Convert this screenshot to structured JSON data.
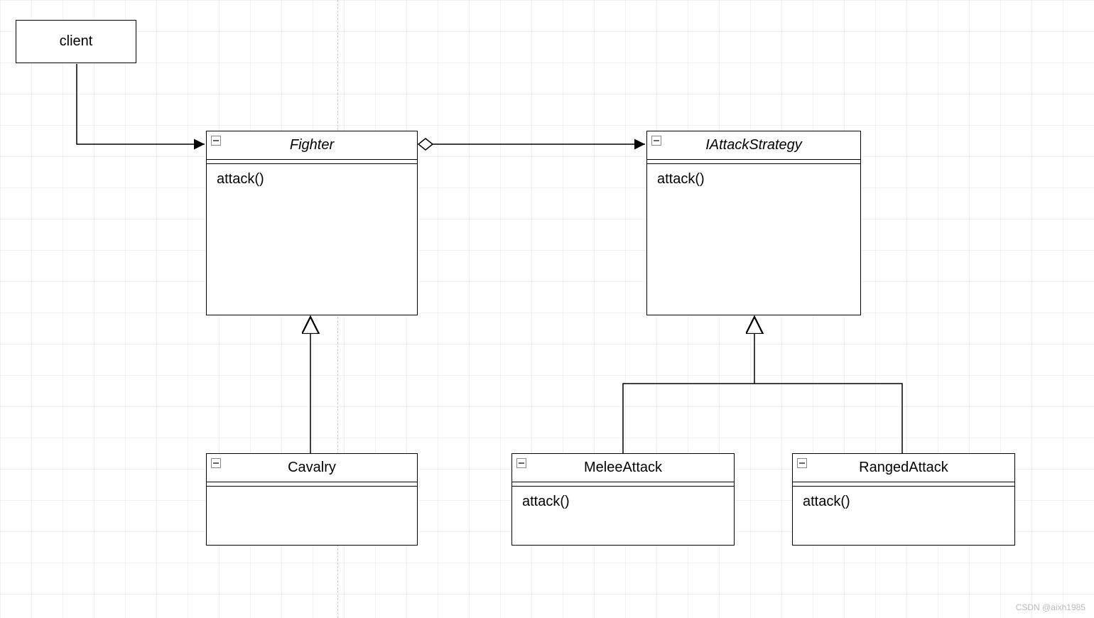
{
  "diagram": {
    "client": {
      "label": "client"
    },
    "fighter": {
      "name": "Fighter",
      "method": "attack()"
    },
    "iattackstrategy": {
      "name": "IAttackStrategy",
      "method": "attack()"
    },
    "cavalry": {
      "name": "Cavalry"
    },
    "meleeattack": {
      "name": "MeleeAttack",
      "method": "attack()"
    },
    "rangedattack": {
      "name": "RangedAttack",
      "method": "attack()"
    }
  },
  "relationships": [
    {
      "from": "client",
      "to": "Fighter",
      "type": "association"
    },
    {
      "from": "Fighter",
      "to": "IAttackStrategy",
      "type": "aggregation"
    },
    {
      "from": "Cavalry",
      "to": "Fighter",
      "type": "generalization"
    },
    {
      "from": "MeleeAttack",
      "to": "IAttackStrategy",
      "type": "generalization"
    },
    {
      "from": "RangedAttack",
      "to": "IAttackStrategy",
      "type": "generalization"
    }
  ],
  "watermark": "CSDN @aixh1985"
}
